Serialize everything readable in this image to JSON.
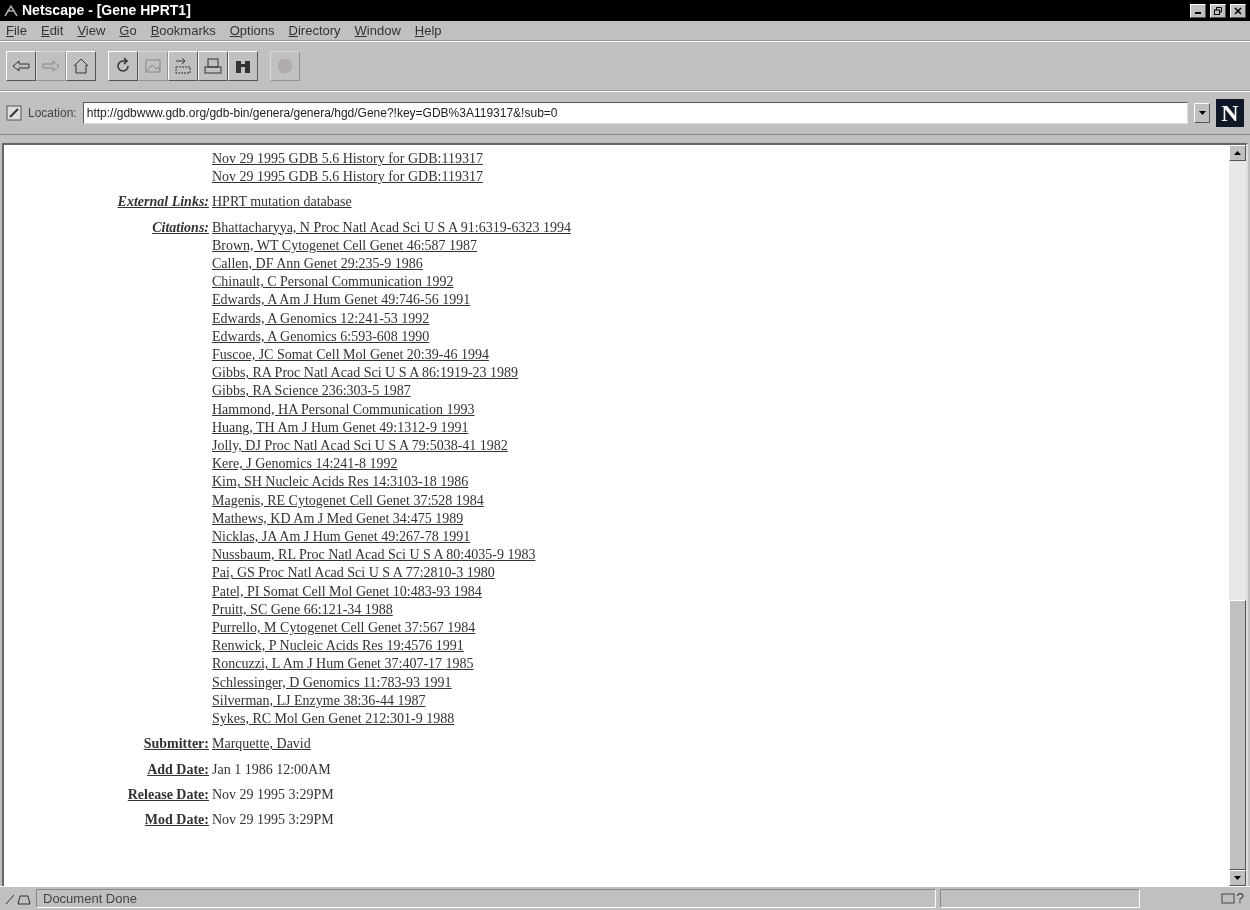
{
  "window": {
    "title": "Netscape - [Gene HPRT1]"
  },
  "menu": [
    "File",
    "Edit",
    "View",
    "Go",
    "Bookmarks",
    "Options",
    "Directory",
    "Window",
    "Help"
  ],
  "toolbar": [
    {
      "kind": "back",
      "disabled": false
    },
    {
      "kind": "forward",
      "disabled": true
    },
    {
      "kind": "home",
      "disabled": false
    },
    {
      "kind": "sep"
    },
    {
      "kind": "reload",
      "disabled": false
    },
    {
      "kind": "images",
      "disabled": true
    },
    {
      "kind": "open",
      "disabled": false
    },
    {
      "kind": "print",
      "disabled": false
    },
    {
      "kind": "find",
      "disabled": false
    },
    {
      "kind": "sep"
    },
    {
      "kind": "stop",
      "disabled": true
    }
  ],
  "location": {
    "label": "Location:",
    "value": "http://gdbwww.gdb.org/gdb-bin/genera/genera/hgd/Gene?!key=GDB%3A119317&!sub=0"
  },
  "logo": "N",
  "fields": [
    {
      "values": [
        "Nov 29 1995 GDB 5.6 History for GDB:119317",
        "Nov 29 1995 GDB 5.6 History for GDB:119317"
      ],
      "links": true
    },
    {
      "label": "External Links:",
      "italic": true,
      "links": true,
      "values": [
        "HPRT mutation database"
      ]
    },
    {
      "label": "Citations:",
      "italic": true,
      "links": true,
      "values": [
        "Bhattacharyya, N Proc Natl Acad Sci U S A 91:6319-6323 1994",
        "Brown, WT Cytogenet Cell Genet 46:587 1987",
        "Callen, DF Ann Genet 29:235-9 1986",
        "Chinault, C Personal Communication 1992",
        "Edwards, A Am J Hum Genet 49:746-56 1991",
        "Edwards, A Genomics 12:241-53 1992",
        "Edwards, A Genomics 6:593-608 1990",
        "Fuscoe, JC Somat Cell Mol Genet 20:39-46 1994",
        "Gibbs, RA Proc Natl Acad Sci U S A 86:1919-23 1989",
        "Gibbs, RA Science 236:303-5 1987",
        "Hammond, HA Personal Communication 1993",
        "Huang, TH Am J Hum Genet 49:1312-9 1991",
        "Jolly, DJ Proc Natl Acad Sci U S A 79:5038-41 1982",
        "Kere, J Genomics 14:241-8 1992",
        "Kim, SH Nucleic Acids Res 14:3103-18 1986",
        "Magenis, RE Cytogenet Cell Genet 37:528 1984",
        "Mathews, KD Am J Med Genet 34:475 1989",
        "Nicklas, JA Am J Hum Genet 49:267-78 1991",
        "Nussbaum, RL Proc Natl Acad Sci U S A 80:4035-9 1983",
        "Pai, GS Proc Natl Acad Sci U S A 77:2810-3 1980",
        "Patel, PI Somat Cell Mol Genet 10:483-93 1984",
        "Pruitt, SC Gene 66:121-34 1988",
        "Purrello, M Cytogenet Cell Genet 37:567 1984",
        "Renwick, P Nucleic Acids Res 19:4576 1991",
        "Roncuzzi, L Am J Hum Genet 37:407-17 1985",
        "Schlessinger, D Genomics 11:783-93 1991",
        "Silverman, LJ Enzyme 38:36-44 1987",
        "Sykes, RC Mol Gen Genet 212:301-9 1988"
      ]
    },
    {
      "label": "Submitter:",
      "italic": false,
      "links": true,
      "values": [
        "Marquette, David"
      ]
    },
    {
      "label": "Add Date:",
      "italic": false,
      "links": false,
      "values": [
        "Jan 1 1986 12:00AM"
      ]
    },
    {
      "label": "Release Date:",
      "italic": false,
      "links": false,
      "values": [
        "Nov 29 1995 3:29PM"
      ]
    },
    {
      "label": "Mod Date:",
      "italic": false,
      "links": false,
      "values": [
        "Nov 29 1995 3:29PM"
      ]
    }
  ],
  "status": {
    "text": "Document Done",
    "help_mark": "?"
  }
}
